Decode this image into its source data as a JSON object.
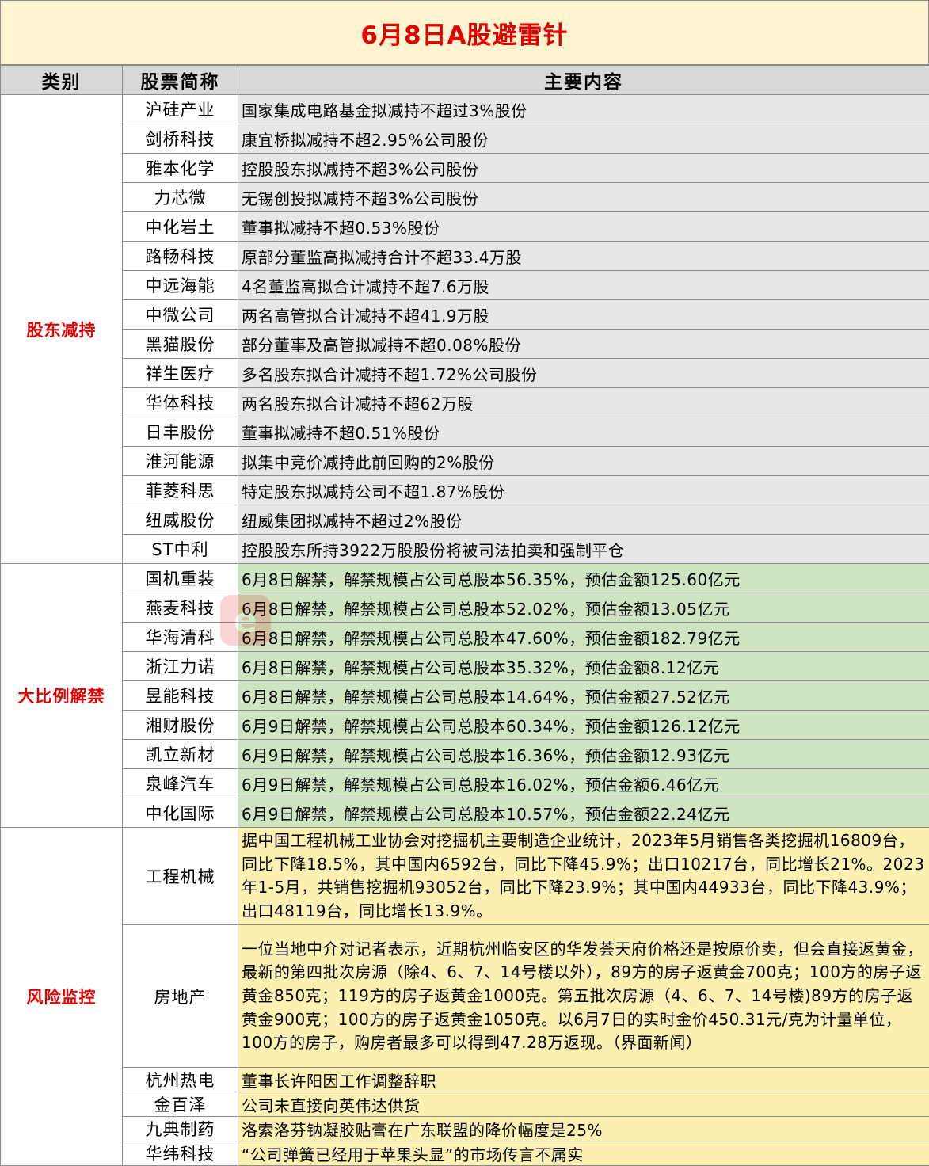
{
  "title": "6月8日A股避雷针",
  "headers": {
    "category": "类别",
    "stock": "股票简称",
    "content": "主要内容"
  },
  "groups": [
    {
      "category": "股东减持",
      "rows": [
        {
          "name": "沪硅产业",
          "content": "国家集成电路基金拟减持不超过3%股份"
        },
        {
          "name": "剑桥科技",
          "content": "康宜桥拟减持不超2.95%公司股份"
        },
        {
          "name": "雅本化学",
          "content": "控股股东拟减持不超3%公司股份"
        },
        {
          "name": "力芯微",
          "content": "无锡创投拟减持不超3%公司股份"
        },
        {
          "name": "中化岩土",
          "content": "董事拟减持不超0.53%股份"
        },
        {
          "name": "路畅科技",
          "content": "原部分董监高拟减持合计不超33.4万股"
        },
        {
          "name": "中远海能",
          "content": "4名董监高拟合计减持不超7.6万股"
        },
        {
          "name": "中微公司",
          "content": "两名高管拟合计减持不超41.9万股"
        },
        {
          "name": "黑猫股份",
          "content": "部分董事及高管拟减持不超0.08%股份"
        },
        {
          "name": "祥生医疗",
          "content": "多名股东拟合计减持不超1.72%公司股份"
        },
        {
          "name": "华体科技",
          "content": "两名股东拟合计减持不超62万股"
        },
        {
          "name": "日丰股份",
          "content": "董事拟减持不超0.51%股份"
        },
        {
          "name": "淮河能源",
          "content": "拟集中竞价减持此前回购的2%股份"
        },
        {
          "name": "菲菱科思",
          "content": "特定股东拟减持公司不超1.87%股份"
        },
        {
          "name": "纽威股份",
          "content": "纽威集团拟减持不超过2%股份"
        },
        {
          "name": "ST中利",
          "content": "控股股东所持3922万股股份将被司法拍卖和强制平仓"
        }
      ]
    },
    {
      "category": "大比例解禁",
      "rows": [
        {
          "name": "国机重装",
          "content": "6月8日解禁，解禁规模占公司总股本56.35%，预估金额125.60亿元"
        },
        {
          "name": "燕麦科技",
          "content": "6月8日解禁，解禁规模占公司总股本52.02%，预估金额13.05亿元"
        },
        {
          "name": "华海清科",
          "content": "6月8日解禁，解禁规模占公司总股本47.60%，预估金额182.79亿元"
        },
        {
          "name": "浙江力诺",
          "content": "6月8日解禁，解禁规模占公司总股本35.32%，预估金额8.12亿元"
        },
        {
          "name": "昱能科技",
          "content": "6月8日解禁，解禁规模占公司总股本14.64%，预估金额27.52亿元"
        },
        {
          "name": "湘财股份",
          "content": "6月9日解禁，解禁规模占公司总股本60.34%，预估金额126.12亿元"
        },
        {
          "name": "凯立新材",
          "content": "6月9日解禁，解禁规模占公司总股本16.36%，预估金额12.93亿元"
        },
        {
          "name": "泉峰汽车",
          "content": "6月9日解禁，解禁规模占公司总股本16.02%，预估金额6.46亿元"
        },
        {
          "name": "中化国际",
          "content": "6月9日解禁，解禁规模占公司总股本10.57%，预估金额22.24亿元"
        }
      ]
    },
    {
      "category": "风险监控",
      "rows": [
        {
          "name": "工程机械",
          "content": "据中国工程机械工业协会对挖掘机主要制造企业统计，2023年5月销售各类挖掘机16809台，同比下降18.5%，其中国内6592台，同比下降45.9%；出口10217台，同比增长21%。2023年1-5月，共销售挖掘机93052台，同比下降23.9%；其中国内44933台，同比下降43.9%；出口48119台，同比增长13.9%。"
        },
        {
          "name": "房地产",
          "content": "一位当地中介对记者表示，近期杭州临安区的华发荟天府价格还是按原价卖，但会直接返黄金，最新的第四批次房源（除4、6、7、14号楼以外），89方的房子返黄金700克；100方的房子返黄金850克；119方的房子返黄金1000克。第五批次房源（4、6、7、14号楼)89方的房子返黄金900克；100方的房子返黄金1050克。以6月7日的实时金价450.31元/克为计量单位，100方的房子，购房者最多可以得到47.28万返现。（界面新闻）"
        },
        {
          "name": "杭州热电",
          "content": "董事长许阳因工作调整辞职"
        },
        {
          "name": "金百泽",
          "content": "公司未直接向英伟达供货"
        },
        {
          "name": "九典制药",
          "content": "洛索洛芬钠凝胶贴膏在广东联盟的降价幅度是25%"
        },
        {
          "name": "华纬科技",
          "content": "“公司弹簧已经用于苹果头显”的市场传言不属实"
        }
      ]
    }
  ],
  "colors": {
    "title_bg": "#fef4d0",
    "title_text": "#e00000",
    "category_text": "#e00000",
    "header_bg": "#d9d9d9",
    "reduce_bg": "#e7e7e7",
    "unlock_bg": "#cfe4c0",
    "risk_bg": "#fdf0b3"
  }
}
